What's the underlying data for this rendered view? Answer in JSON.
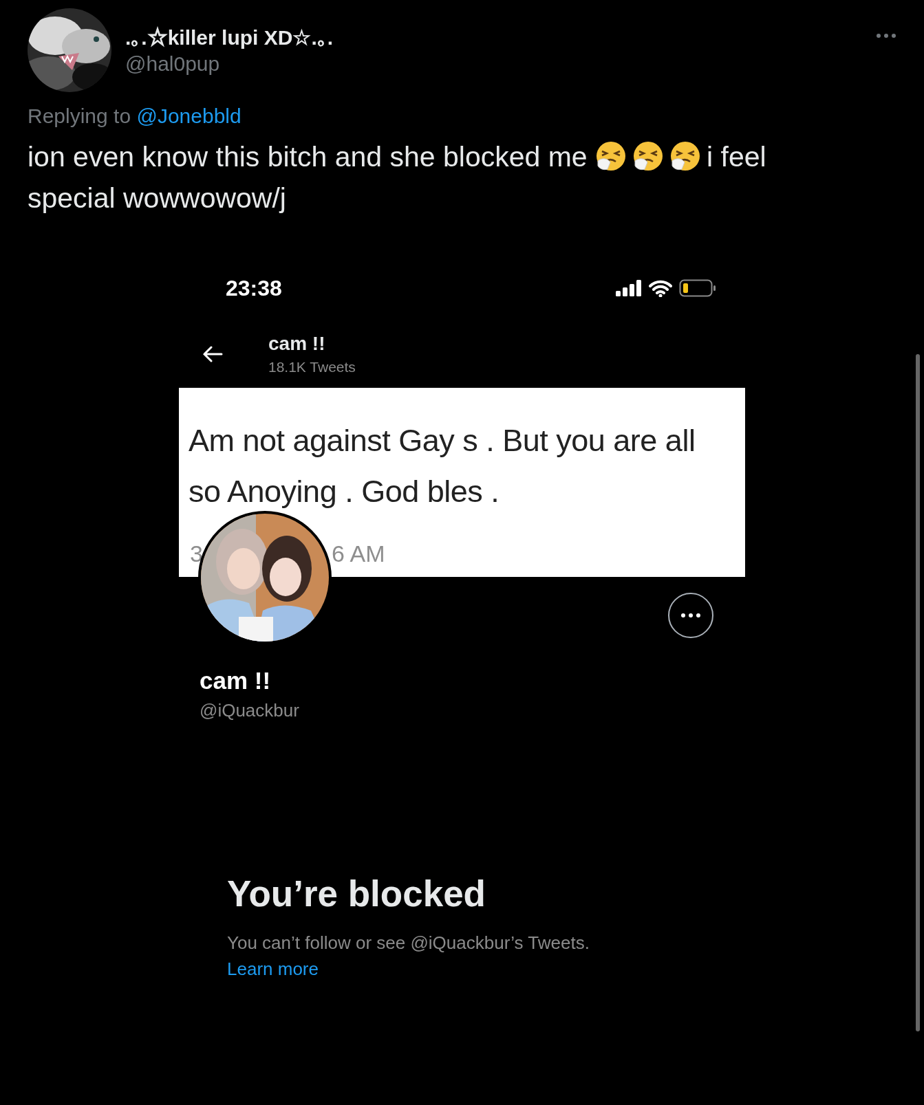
{
  "tweet": {
    "author_name": ".｡.☆killer lupi XD☆.｡.",
    "handle": "@hal0pup",
    "reply_prefix": "Replying to",
    "reply_to": "@Jonebbld",
    "text_before": "ion even know this bitch and she blocked me",
    "emojis": [
      {
        "kind": "sneezing"
      },
      {
        "kind": "sneezing"
      },
      {
        "kind": "sneezing"
      }
    ],
    "text_after": [
      "i feel",
      "special wowwowow/j"
    ]
  },
  "screenshot": {
    "status_time": "23:38",
    "header": {
      "name": "cam !!",
      "tweet_count": "18.1K Tweets"
    },
    "banner": {
      "lines": [
        "Am not against Gay s . But you are all",
        "so Anoying . God bles ."
      ],
      "time_parts": [
        "3",
        "6 AM"
      ]
    },
    "profile": {
      "name": "cam !!",
      "handle": "@iQuackbur"
    },
    "blocked": {
      "title": "You’re blocked",
      "message": "You can’t follow or see @iQuackbur’s Tweets.",
      "link": "Learn more"
    }
  }
}
